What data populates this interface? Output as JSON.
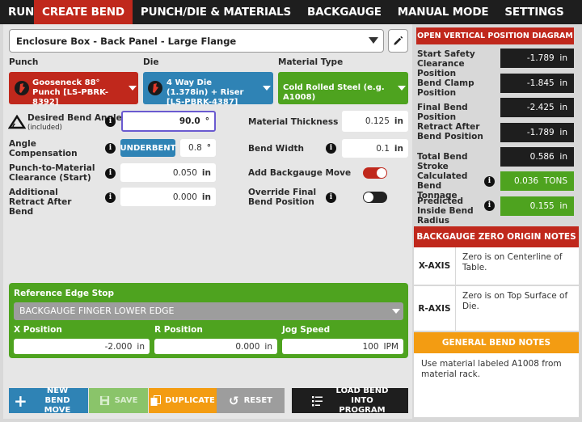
{
  "nav": {
    "tabs": [
      "RUN",
      "CREATE BEND",
      "PUNCH/DIE & MATERIALS",
      "BACKGAUGE",
      "MANUAL MODE",
      "SETTINGS"
    ],
    "active": "CREATE BEND"
  },
  "job": {
    "name": "Enclosure Box - Back Panel - Large Flange"
  },
  "tooling": {
    "punch_label": "Punch",
    "punch_value": "Gooseneck 88° Punch [LS-PBRK-8392]",
    "die_label": "Die",
    "die_value": "4 Way Die (1.378in) + Riser [LS-PBRK-4387]",
    "material_label": "Material Type",
    "material_value": "Cold Rolled Steel (e.g. A1008)"
  },
  "params": {
    "angle_label": "Desired Bend Angle",
    "angle_sub": "(included)",
    "angle_value": "90.0",
    "angle_unit": "°",
    "comp_label": "Angle Compensation",
    "comp_mode": "UNDERBENT",
    "comp_value": "0.8",
    "comp_unit": "°",
    "clear_label": "Punch-to-Material Clearance (Start)",
    "clear_value": "0.050",
    "clear_unit": "in",
    "retract_label": "Additional Retract After Bend",
    "retract_value": "0.000",
    "retract_unit": "in",
    "thick_label": "Material Thickness",
    "thick_value": "0.125",
    "thick_unit": "in",
    "width_label": "Bend Width",
    "width_value": "0.1",
    "width_unit": "in",
    "bgmove_label": "Add Backgauge Move",
    "bgmove_on": true,
    "override_label": "Override Final Bend Position",
    "override_on": false
  },
  "reference": {
    "title": "Reference Edge Stop",
    "stop": "BACKGAUGE FINGER LOWER EDGE",
    "x_label": "X Position",
    "x_value": "-2.000",
    "x_unit": "in",
    "r_label": "R Position",
    "r_value": "0.000",
    "r_unit": "in",
    "jog_label": "Jog Speed",
    "jog_value": "100",
    "jog_unit": "IPM"
  },
  "buttons": {
    "new_bend": "NEW BEND MOVE",
    "save": "SAVE",
    "duplicate": "DUPLICATE",
    "reset": "RESET",
    "load": "LOAD BEND INTO PROGRAM"
  },
  "vertical": {
    "diagram_button": "OPEN VERTICAL POSITION DIAGRAM",
    "rows": [
      {
        "label": "Start Safety Clearance Position",
        "value": "-1.789",
        "unit": "in"
      },
      {
        "label": "Bend Clamp Position",
        "value": "-1.845",
        "unit": "in"
      },
      {
        "label": "Final Bend Position",
        "value": "-2.425",
        "unit": "in"
      },
      {
        "label": "Retract After Bend Position",
        "value": "-1.789",
        "unit": "in"
      },
      {
        "label": "Total Bend Stroke",
        "value": "0.586",
        "unit": "in"
      },
      {
        "label": "Calculated Bend Tonnage",
        "value": "0.036",
        "unit": "TONS"
      },
      {
        "label": "Predicted Inside Bend Radius",
        "value": "0.155",
        "unit": "in"
      }
    ]
  },
  "notes": {
    "origin_title": "BACKGAUGE ZERO ORIGIN NOTES",
    "x_axis": "X-AXIS",
    "x_text": "Zero is on Centerline of Table.",
    "r_axis": "R-AXIS",
    "r_text": "Zero is on Top Surface of Die.",
    "general_title": "GENERAL BEND NOTES",
    "general_text": "Use material labeled A1008 from material rack."
  },
  "colors": {
    "red": "#c0281c",
    "blue": "#2f83b5",
    "green": "#4ea31f",
    "orange": "#f39c12"
  }
}
